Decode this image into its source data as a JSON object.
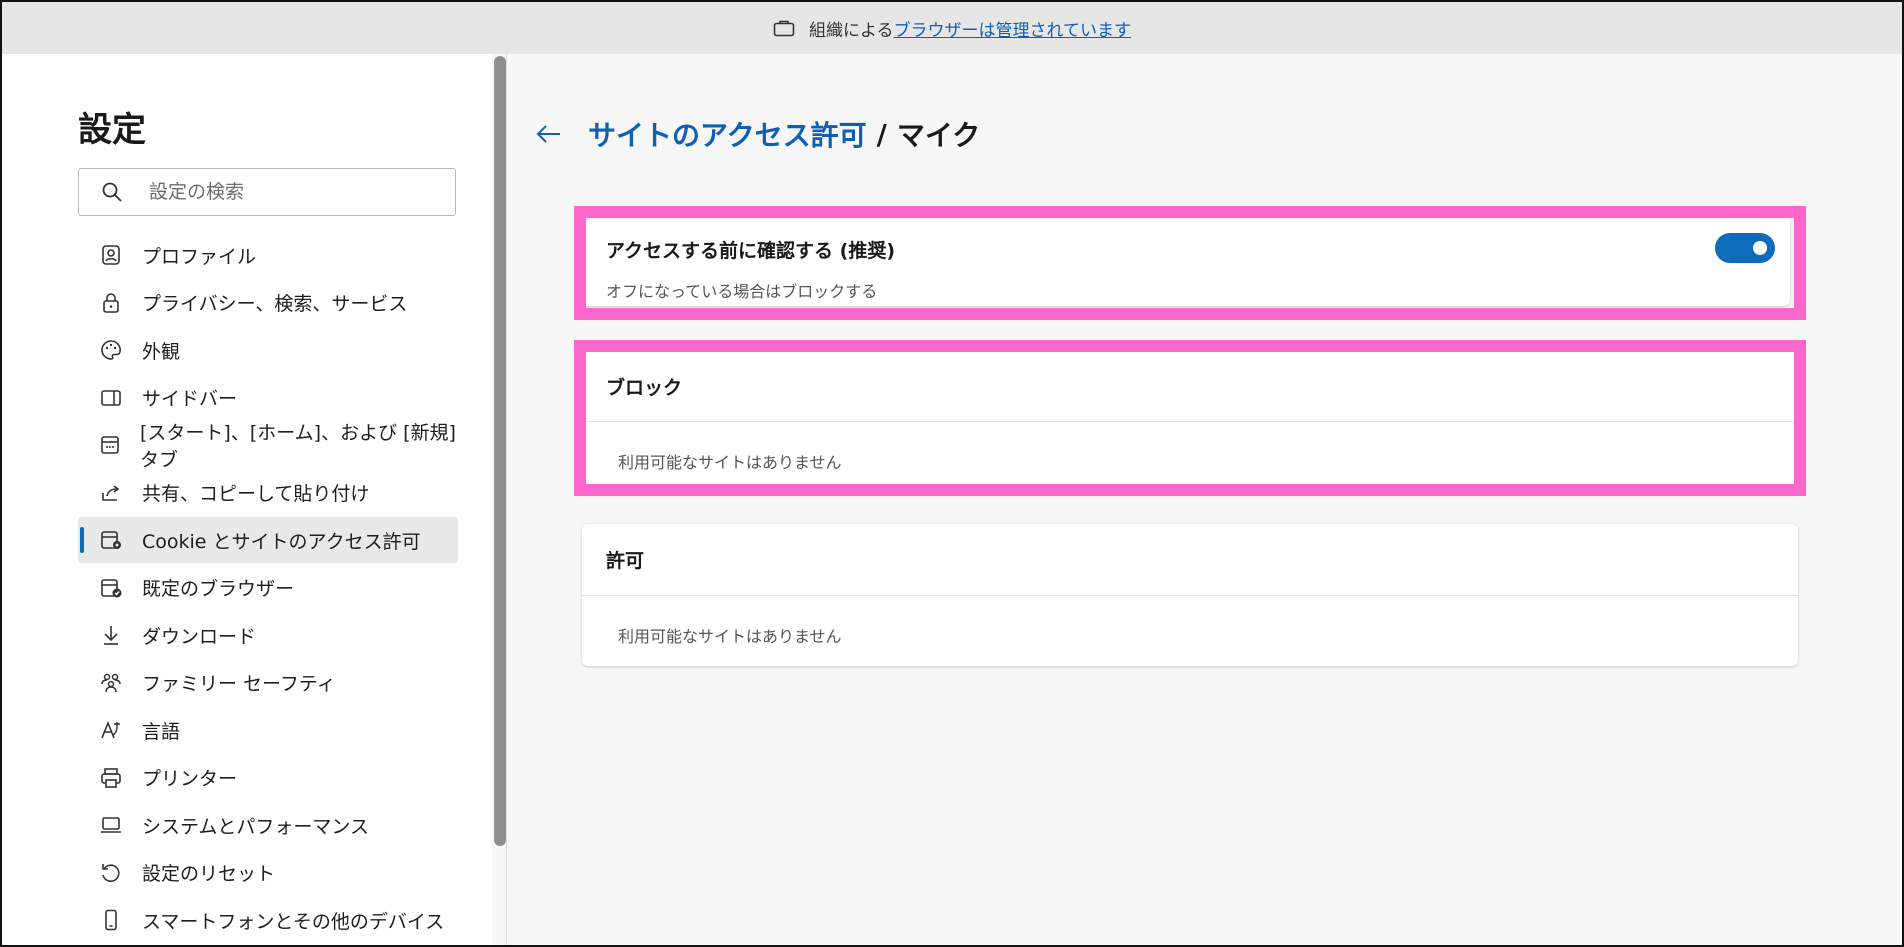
{
  "banner": {
    "prefix": "組織による",
    "link": "ブラウザーは管理されています"
  },
  "sidebar": {
    "title": "設定",
    "search_placeholder": "設定の検索",
    "items": [
      {
        "label": "プロファイル",
        "icon": "profile-icon"
      },
      {
        "label": "プライバシー、検索、サービス",
        "icon": "lock-icon"
      },
      {
        "label": "外観",
        "icon": "palette-icon"
      },
      {
        "label": "サイドバー",
        "icon": "sidebar-icon"
      },
      {
        "label": "[スタート]、[ホーム]、および [新規] タブ",
        "icon": "home-tab-icon"
      },
      {
        "label": "共有、コピーして貼り付け",
        "icon": "share-icon"
      },
      {
        "label": "Cookie とサイトのアクセス許可",
        "icon": "cookie-settings-icon",
        "active": true
      },
      {
        "label": "既定のブラウザー",
        "icon": "default-browser-icon"
      },
      {
        "label": "ダウンロード",
        "icon": "download-icon"
      },
      {
        "label": "ファミリー セーフティ",
        "icon": "family-icon"
      },
      {
        "label": "言語",
        "icon": "language-icon"
      },
      {
        "label": "プリンター",
        "icon": "printer-icon"
      },
      {
        "label": "システムとパフォーマンス",
        "icon": "system-icon"
      },
      {
        "label": "設定のリセット",
        "icon": "reset-icon"
      },
      {
        "label": "スマートフォンとその他のデバイス",
        "icon": "phone-icon"
      }
    ]
  },
  "main": {
    "breadcrumb_parent": "サイトのアクセス許可",
    "breadcrumb_sep": "/",
    "breadcrumb_current": "マイク",
    "ask_card": {
      "title": "アクセスする前に確認する (推奨)",
      "subtitle": "オフになっている場合はブロックする",
      "toggle_on": true
    },
    "block_card": {
      "title": "ブロック",
      "empty": "利用可能なサイトはありません"
    },
    "allow_card": {
      "title": "許可",
      "empty": "利用可能なサイトはありません"
    },
    "highlight_color": "#ff66cc",
    "accent_color": "#0f6cbd"
  }
}
